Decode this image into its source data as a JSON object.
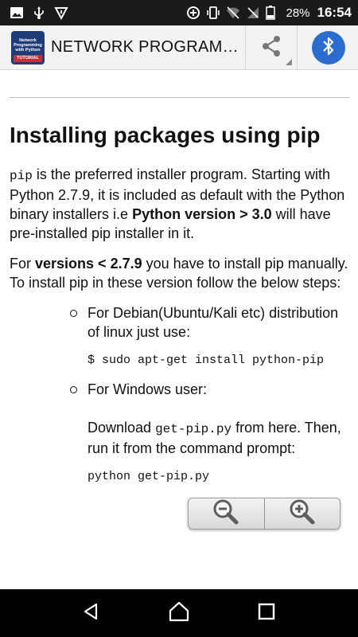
{
  "status_bar": {
    "battery_percent": "28%",
    "time": "16:54",
    "icons": [
      "image-icon",
      "usb-icon",
      "debug-icon",
      "data-saver-icon",
      "vibrate-icon",
      "wifi-icon",
      "signal-icon",
      "battery-icon"
    ]
  },
  "app_bar": {
    "title": "NETWORK PROGRAM…",
    "logo_text": "Network Programming with Python",
    "logo_tag": "TUTORIAL",
    "share_icon": "share-icon",
    "bluetooth_icon": "bluetooth-icon"
  },
  "article": {
    "heading": "Installing packages using pip",
    "p1_code": "pip",
    "p1_text_a": " is the preferred installer program. Starting with Python 2.7.9, it is included as default with the Python binary installers i.e ",
    "p1_bold": "Python version > 3.0",
    "p1_text_b": " will have pre-installed pip installer in it.",
    "p2_text_a": "For ",
    "p2_bold": "versions < 2.7.9",
    "p2_text_b": " you have to install pip manually. To install pip in these version follow the below steps:",
    "steps": [
      {
        "text": "For Debian(Ubuntu/Kali etc) distribution of linux just use:",
        "code": "$ sudo apt-get install python-pip"
      },
      {
        "text": "For Windows user:",
        "detail_a": "Download ",
        "detail_code": "get-pip.py",
        "detail_b": " from here. Then, run it from the command prompt:",
        "code": "python get-pip.py"
      }
    ]
  },
  "zoom_controls": {
    "zoom_out_icon": "zoom-out-icon",
    "zoom_in_icon": "zoom-in-icon"
  },
  "nav_bar": {
    "back_icon": "back-icon",
    "home_icon": "home-icon",
    "recents_icon": "recents-icon"
  }
}
